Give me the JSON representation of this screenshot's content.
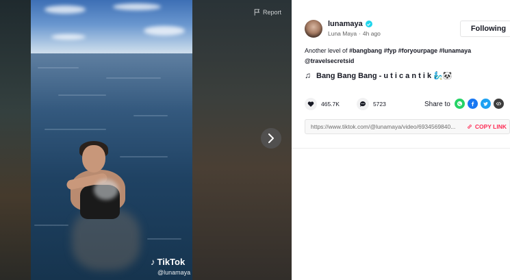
{
  "video": {
    "report_label": "Report",
    "watermark_brand": "TikTok",
    "watermark_user": "@lunamaya"
  },
  "author": {
    "username": "lunamaya",
    "display_name": "Luna Maya",
    "separator": "·",
    "posted": "4h ago",
    "follow_label": "Following"
  },
  "caption": {
    "prefix": "Another level of ",
    "tags": [
      "#bangbang",
      "#fyp",
      "#foryourpage",
      "#lunamaya"
    ],
    "mention": "@travelsecretsid"
  },
  "music": {
    "title": "Bang Bang Bang - u t i c a n t i k 🧞‍♂️🐼"
  },
  "stats": {
    "likes": "465.7K",
    "comments": "5723"
  },
  "share": {
    "label": "Share to",
    "targets": [
      "whatsapp-icon",
      "facebook-icon",
      "twitter-icon",
      "embed-icon"
    ]
  },
  "link": {
    "url": "https://www.tiktok.com/@lunamaya/video/6934569840...",
    "copy_label": "COPY LINK"
  },
  "colors": {
    "accent": "#fe2c55",
    "verified": "#20d5ec",
    "whatsapp": "#25d366",
    "facebook": "#1877f2",
    "twitter": "#1da1f2",
    "embed": "#3d3d3d"
  }
}
